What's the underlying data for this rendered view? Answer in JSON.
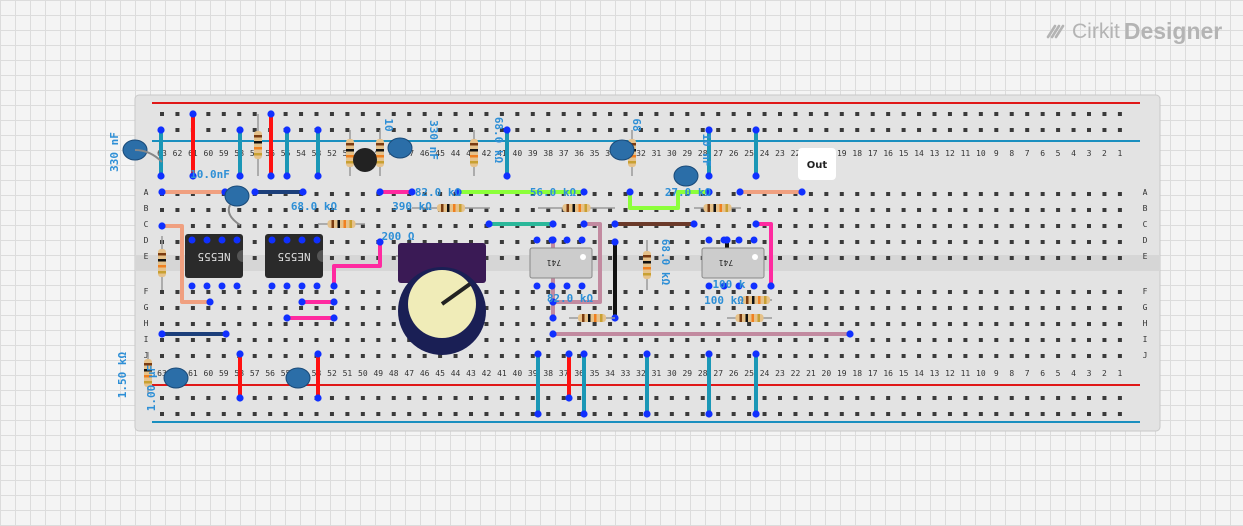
{
  "brand": {
    "logo_icon": "cirkit-logo-icon",
    "name_a": "Cirkit",
    "name_b": "Designer"
  },
  "colors": {
    "board": "#e3e3e3",
    "hole": "#3a3a3a",
    "rail_red": "#e01818",
    "rail_blue": "#1a8fbf",
    "wire_red": "#ff1010",
    "wire_teal": "#1a97b6",
    "wire_navy": "#1c3f7a",
    "wire_pink": "#ff2aa0",
    "wire_salmon": "#f0a080",
    "wire_mauve": "#c28aa0",
    "wire_green": "#8cff3a",
    "wire_brown": "#6b3a2a",
    "wire_black": "#111111",
    "wire_mint": "#2bb89a",
    "node": "#1030ff",
    "label": "#2e8fd6",
    "ic_body": "#2a2a2a",
    "opamp_body": "#cccccc"
  },
  "board": {
    "row_letters_top": [
      "A",
      "B",
      "C",
      "D",
      "E"
    ],
    "row_letters_bottom": [
      "F",
      "G",
      "H",
      "I",
      "J"
    ],
    "columns": [
      "63",
      "62",
      "61",
      "60",
      "59",
      "58",
      "57",
      "56",
      "55",
      "54",
      "53",
      "52",
      "51",
      "50",
      "49",
      "48",
      "47",
      "46",
      "45",
      "44",
      "43",
      "42",
      "41",
      "40",
      "39",
      "38",
      "37",
      "36",
      "35",
      "34",
      "33",
      "32",
      "31",
      "30",
      "29",
      "28",
      "27",
      "26",
      "25",
      "24",
      "23",
      "22",
      "21",
      "20",
      "19",
      "18",
      "17",
      "16",
      "15",
      "14",
      "13",
      "12",
      "11",
      "10",
      "9",
      "8",
      "7",
      "6",
      "5",
      "4",
      "3",
      "2",
      "1"
    ]
  },
  "chips": [
    {
      "label": "NE555",
      "icon": "ne555-ic"
    },
    {
      "label": "NE555",
      "icon": "ne555-ic"
    }
  ],
  "opamps": [
    {
      "label": "741",
      "icon": "op-amp-741-ic"
    },
    {
      "label": "741",
      "icon": "op-amp-741-ic"
    }
  ],
  "potentiometer": {
    "icon": "potentiometer-icon"
  },
  "transistor": {
    "icon": "transistor-icon"
  },
  "output_label": "Out",
  "component_labels": [
    "330 nF",
    "10.0nF",
    "68.0 kΩ",
    "390 kΩ",
    "200 Ω",
    "330 nF",
    "68.0 kΩ",
    "82.0 kΩ",
    "56.0 kΩ",
    "27.0 kΩ",
    "10 nF",
    "68",
    "68.0 kΩ",
    "82.0 kΩ",
    "100 k",
    "100 kΩ",
    "1.50 kΩ",
    "1.00 µF",
    "10"
  ]
}
